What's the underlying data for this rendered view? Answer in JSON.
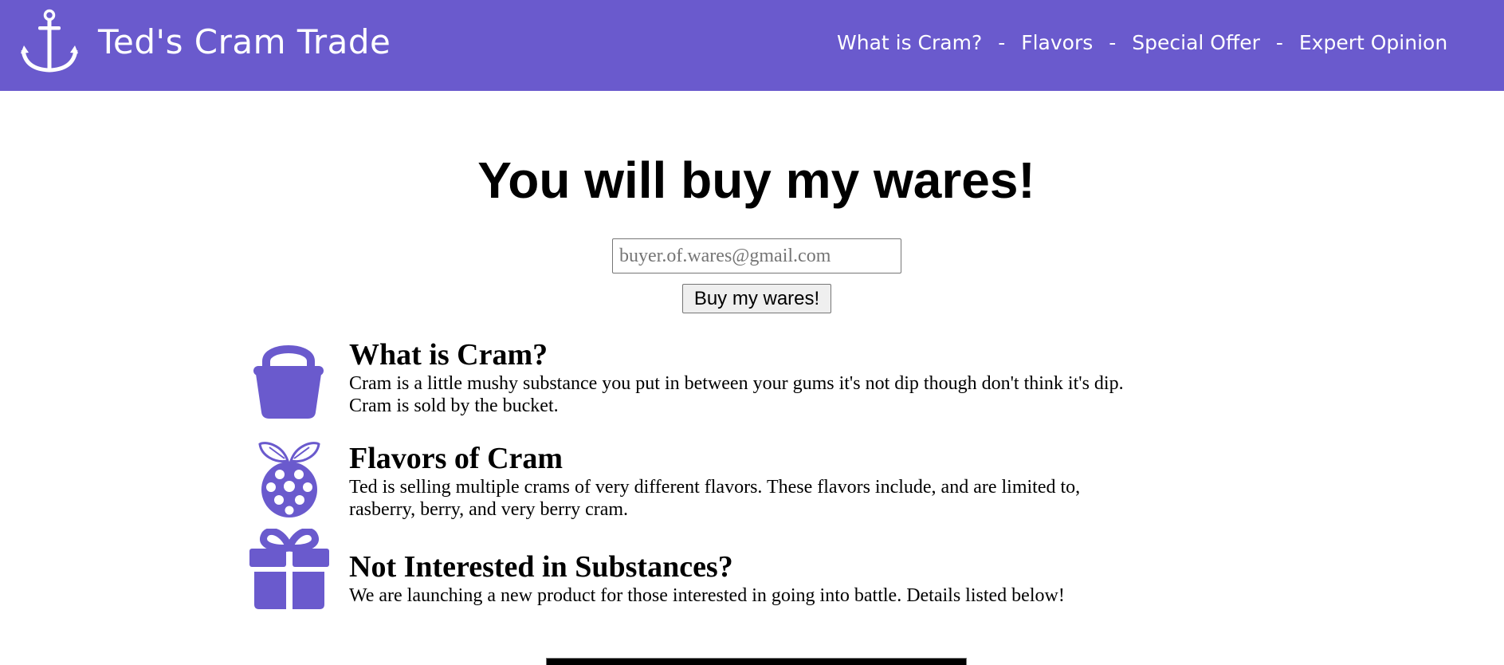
{
  "header": {
    "logo_icon": "anchor-icon",
    "title": "Ted's Cram Trade",
    "bg_color": "#6a5acd",
    "nav": {
      "items": [
        "What is Cram?",
        "Flavors",
        "Special Offer",
        "Expert Opinion"
      ],
      "separator": "-"
    }
  },
  "hero": {
    "title": "You will buy my wares!",
    "email_placeholder": "buyer.of.wares@gmail.com",
    "email_value": "",
    "button_label": "Buy my wares!"
  },
  "features": [
    {
      "icon": "bucket-icon",
      "title": "What is Cram?",
      "lines": [
        "Cram is a little mushy substance you put in between your gums it's not dip though don't think it's dip.",
        "Cram is sold by the bucket."
      ]
    },
    {
      "icon": "raspberry-icon",
      "title": "Flavors of Cram",
      "lines": [
        "Ted is selling multiple crams of very different flavors. These flavors include, and are limited to,",
        "rasberry, berry, and very berry cram."
      ]
    },
    {
      "icon": "gift-icon",
      "title": "Not Interested in Substances?",
      "lines": [
        "We are launching a new product for those interested in going into battle. Details listed below!"
      ]
    }
  ],
  "accent_color": "#6a5acd"
}
